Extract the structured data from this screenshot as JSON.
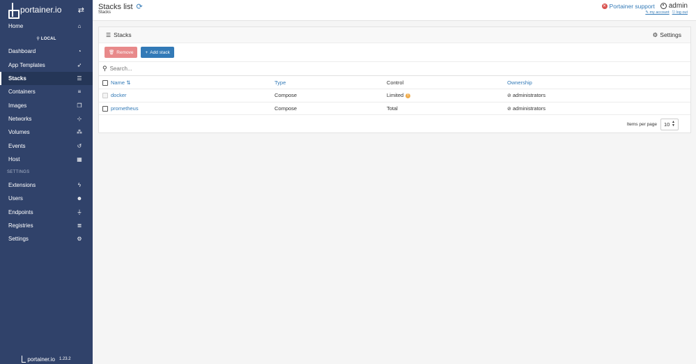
{
  "sidebar": {
    "brand": "portainer.io",
    "home": "Home",
    "endpoint": "LOCAL",
    "items": [
      {
        "label": "Dashboard",
        "icon": "tachometer-icon"
      },
      {
        "label": "App Templates",
        "icon": "rocket-icon"
      },
      {
        "label": "Stacks",
        "icon": "th-list-icon",
        "active": true
      },
      {
        "label": "Containers",
        "icon": "server-icon"
      },
      {
        "label": "Images",
        "icon": "clone-icon"
      },
      {
        "label": "Networks",
        "icon": "sitemap-icon"
      },
      {
        "label": "Volumes",
        "icon": "cubes-icon"
      },
      {
        "label": "Events",
        "icon": "history-icon"
      },
      {
        "label": "Host",
        "icon": "th-icon"
      }
    ],
    "settings_section": "SETTINGS",
    "settings_items": [
      {
        "label": "Extensions",
        "icon": "bolt-icon"
      },
      {
        "label": "Users",
        "icon": "users-icon"
      },
      {
        "label": "Endpoints",
        "icon": "plug-icon"
      },
      {
        "label": "Registries",
        "icon": "database-icon"
      },
      {
        "label": "Settings",
        "icon": "cogs-icon"
      }
    ],
    "footer_brand": "portainer.io",
    "version": "1.23.2"
  },
  "header": {
    "title": "Stacks list",
    "breadcrumb": "Stacks",
    "support": "Portainer support",
    "username": "admin",
    "my_account": "my account",
    "log_out": "log out"
  },
  "panel": {
    "title": "Stacks",
    "settings": "Settings",
    "remove_label": "Remove",
    "add_label": "Add stack",
    "search_placeholder": "Search...",
    "columns": {
      "name": "Name",
      "type": "Type",
      "control": "Control",
      "ownership": "Ownership"
    },
    "rows": [
      {
        "name": "docker",
        "type": "Compose",
        "control": "Limited",
        "ownership": "administrators"
      },
      {
        "name": "prometheus",
        "type": "Compose",
        "control": "Total",
        "ownership": "administrators"
      }
    ],
    "items_per_page_label": "Items per page",
    "items_per_page": "10"
  },
  "colors": {
    "sidebar": "#30426a",
    "link": "#337ab7",
    "remove": "#e8898a",
    "warning": "#f0ad4e"
  }
}
